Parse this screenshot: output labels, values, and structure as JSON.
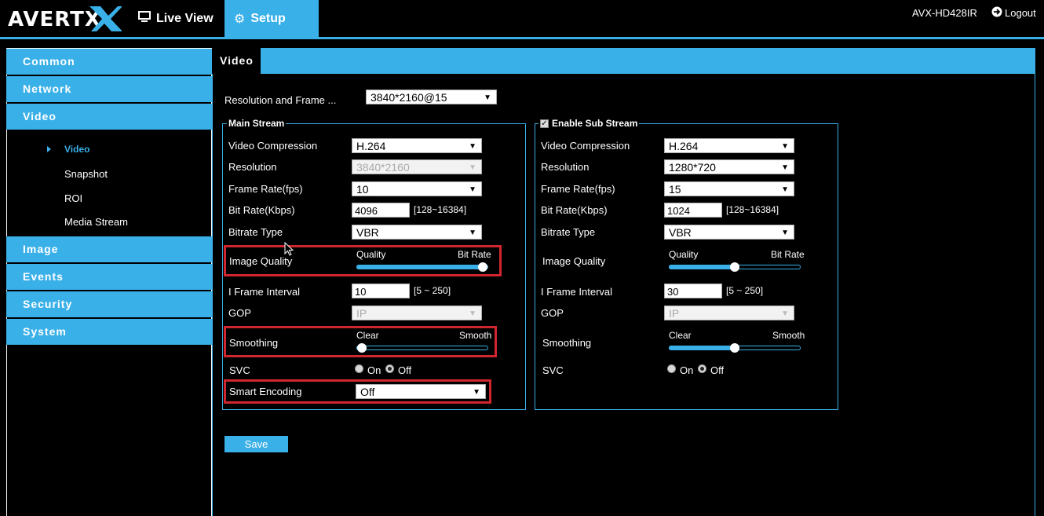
{
  "header": {
    "logo": "AVERTX",
    "tabs": [
      {
        "label": "Live View",
        "icon": "monitor-icon"
      },
      {
        "label": "Setup",
        "icon": "gear-icon"
      }
    ],
    "model": "AVX-HD428IR",
    "logout_label": "Logout"
  },
  "sidebar": {
    "sections": [
      "Common",
      "Network",
      "Video",
      "Image",
      "Events",
      "Security",
      "System"
    ],
    "video_subitems": [
      "Video",
      "Snapshot",
      "ROI",
      "Media Stream"
    ]
  },
  "main": {
    "tab": "Video",
    "resolution_frame_label": "Resolution and Frame ...",
    "resolution_frame_value": "3840*2160@15",
    "save_label": "Save"
  },
  "main_stream": {
    "legend": "Main Stream",
    "video_compression_label": "Video Compression",
    "video_compression": "H.264",
    "resolution_label": "Resolution",
    "resolution": "3840*2160",
    "frame_rate_label": "Frame Rate(fps)",
    "frame_rate": "10",
    "bit_rate_label": "Bit Rate(Kbps)",
    "bit_rate": "4096",
    "bit_rate_range": "[128~16384]",
    "bitrate_type_label": "Bitrate Type",
    "bitrate_type": "VBR",
    "image_quality_label": "Image Quality",
    "image_quality_left": "Quality",
    "image_quality_right": "Bit Rate",
    "image_quality_level": 1.0,
    "iframe_label": "I Frame Interval",
    "iframe": "10",
    "iframe_range": "[5 ~ 250]",
    "gop_label": "GOP",
    "gop": "IP",
    "smoothing_label": "Smoothing",
    "smoothing_left": "Clear",
    "smoothing_right": "Smooth",
    "smoothing_level": 0.0,
    "svc_label": "SVC",
    "svc_on": "On",
    "svc_off": "Off",
    "svc_value": "Off",
    "smart_encoding_label": "Smart Encoding",
    "smart_encoding": "Off"
  },
  "sub_stream": {
    "legend": "Enable  Sub Stream",
    "enabled": true,
    "video_compression_label": "Video Compression",
    "video_compression": "H.264",
    "resolution_label": "Resolution",
    "resolution": "1280*720",
    "frame_rate_label": "Frame Rate(fps)",
    "frame_rate": "15",
    "bit_rate_label": "Bit Rate(Kbps)",
    "bit_rate": "1024",
    "bit_rate_range": "[128~16384]",
    "bitrate_type_label": "Bitrate Type",
    "bitrate_type": "VBR",
    "image_quality_label": "Image Quality",
    "image_quality_left": "Quality",
    "image_quality_right": "Bit Rate",
    "image_quality_level": 0.5,
    "iframe_label": "I Frame Interval",
    "iframe": "30",
    "iframe_range": "[5 ~ 250]",
    "gop_label": "GOP",
    "gop": "IP",
    "smoothing_label": "Smoothing",
    "smoothing_left": "Clear",
    "smoothing_right": "Smooth",
    "smoothing_level": 0.5,
    "svc_label": "SVC",
    "svc_on": "On",
    "svc_off": "Off",
    "svc_value": "Off"
  },
  "colors": {
    "accent": "#3ab0e8",
    "highlight": "#d0262e",
    "background": "#000000"
  }
}
